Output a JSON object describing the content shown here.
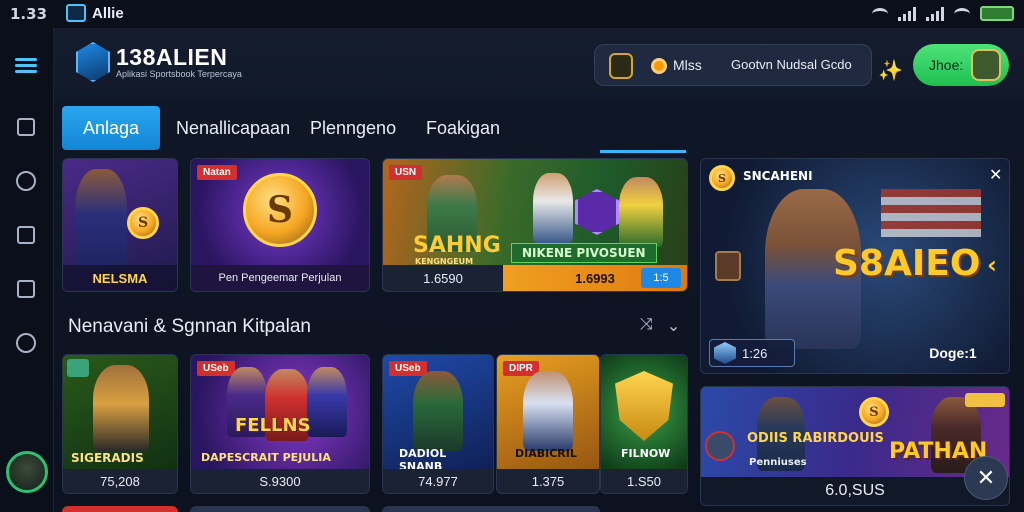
{
  "statusbar": {
    "time": "1.33",
    "app_name": "Allie"
  },
  "header": {
    "logo_title": "138ALIEN",
    "logo_subtitle": "Aplikasi Sportsbook Terpercaya",
    "pill_label1": "Mlss",
    "pill_label2": "Gootvn Nudsal Gcdo",
    "cta_label": "Jhoe:"
  },
  "tabs": [
    {
      "label": "Anlaga"
    },
    {
      "label": "Nenallicapaan"
    },
    {
      "label": "Plenngeno"
    },
    {
      "label": "Foakigan"
    }
  ],
  "top_cards": [
    {
      "tag": "",
      "caption": "NELSMA"
    },
    {
      "tag": "Natan",
      "caption": "Pen Pengeemar Perjulan"
    },
    {
      "tag": "USN",
      "title": "SAHNG",
      "subtitle": "KENGNGEUM",
      "badge": "NIKENE PIVOSUEN",
      "left_value": "1.6590",
      "right_value": "1.6993",
      "right_chip": "1:5"
    },
    {
      "tag": "SNCAHENI",
      "title": "S8AIEO",
      "left_value": "1:26",
      "right_value": "Doge:1"
    }
  ],
  "section": {
    "title": "Nenavani & Sgnnan Kitpalan"
  },
  "bottom_cards": [
    {
      "tag": "",
      "caption": "SIGERADIS",
      "value": "75,208"
    },
    {
      "tag": "USeb",
      "caption": "DAPESCRAIT PEJULIA",
      "overlay": "FELLNS",
      "value": "S.9300"
    },
    {
      "tag": "USeb",
      "caption": "DADIOL SNANB",
      "value": "74.977"
    },
    {
      "tag": "DIPR",
      "caption": "DIABICRIL",
      "value": "1.375"
    },
    {
      "tag": "",
      "caption": "FILNOW",
      "value": "1.S50"
    },
    {
      "tag": "",
      "title": "ODIIS RABIRDOUIS",
      "subtitle": "Penniuses",
      "right_title": "PATHAN",
      "value": "6.0,SUS"
    }
  ],
  "colors": {
    "accent": "#1e90e0",
    "cta": "#22c55e",
    "tag": "#d32f2f"
  }
}
